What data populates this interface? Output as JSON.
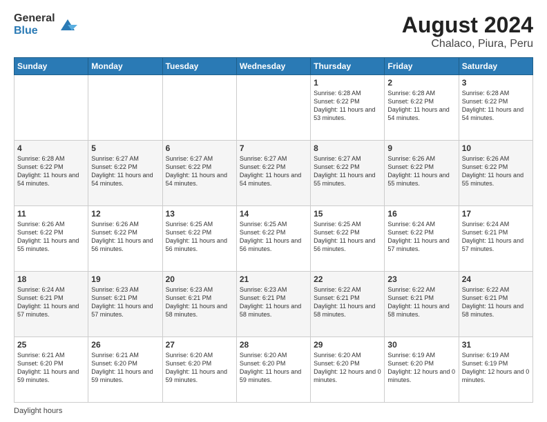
{
  "header": {
    "logo_general": "General",
    "logo_blue": "Blue",
    "title": "August 2024",
    "location": "Chalaco, Piura, Peru"
  },
  "weekdays": [
    "Sunday",
    "Monday",
    "Tuesday",
    "Wednesday",
    "Thursday",
    "Friday",
    "Saturday"
  ],
  "weeks": [
    [
      {
        "day": "",
        "info": ""
      },
      {
        "day": "",
        "info": ""
      },
      {
        "day": "",
        "info": ""
      },
      {
        "day": "",
        "info": ""
      },
      {
        "day": "1",
        "info": "Sunrise: 6:28 AM\nSunset: 6:22 PM\nDaylight: 11 hours\nand 53 minutes."
      },
      {
        "day": "2",
        "info": "Sunrise: 6:28 AM\nSunset: 6:22 PM\nDaylight: 11 hours\nand 54 minutes."
      },
      {
        "day": "3",
        "info": "Sunrise: 6:28 AM\nSunset: 6:22 PM\nDaylight: 11 hours\nand 54 minutes."
      }
    ],
    [
      {
        "day": "4",
        "info": "Sunrise: 6:28 AM\nSunset: 6:22 PM\nDaylight: 11 hours\nand 54 minutes."
      },
      {
        "day": "5",
        "info": "Sunrise: 6:27 AM\nSunset: 6:22 PM\nDaylight: 11 hours\nand 54 minutes."
      },
      {
        "day": "6",
        "info": "Sunrise: 6:27 AM\nSunset: 6:22 PM\nDaylight: 11 hours\nand 54 minutes."
      },
      {
        "day": "7",
        "info": "Sunrise: 6:27 AM\nSunset: 6:22 PM\nDaylight: 11 hours\nand 54 minutes."
      },
      {
        "day": "8",
        "info": "Sunrise: 6:27 AM\nSunset: 6:22 PM\nDaylight: 11 hours\nand 55 minutes."
      },
      {
        "day": "9",
        "info": "Sunrise: 6:26 AM\nSunset: 6:22 PM\nDaylight: 11 hours\nand 55 minutes."
      },
      {
        "day": "10",
        "info": "Sunrise: 6:26 AM\nSunset: 6:22 PM\nDaylight: 11 hours\nand 55 minutes."
      }
    ],
    [
      {
        "day": "11",
        "info": "Sunrise: 6:26 AM\nSunset: 6:22 PM\nDaylight: 11 hours\nand 55 minutes."
      },
      {
        "day": "12",
        "info": "Sunrise: 6:26 AM\nSunset: 6:22 PM\nDaylight: 11 hours\nand 56 minutes."
      },
      {
        "day": "13",
        "info": "Sunrise: 6:25 AM\nSunset: 6:22 PM\nDaylight: 11 hours\nand 56 minutes."
      },
      {
        "day": "14",
        "info": "Sunrise: 6:25 AM\nSunset: 6:22 PM\nDaylight: 11 hours\nand 56 minutes."
      },
      {
        "day": "15",
        "info": "Sunrise: 6:25 AM\nSunset: 6:22 PM\nDaylight: 11 hours\nand 56 minutes."
      },
      {
        "day": "16",
        "info": "Sunrise: 6:24 AM\nSunset: 6:22 PM\nDaylight: 11 hours\nand 57 minutes."
      },
      {
        "day": "17",
        "info": "Sunrise: 6:24 AM\nSunset: 6:21 PM\nDaylight: 11 hours\nand 57 minutes."
      }
    ],
    [
      {
        "day": "18",
        "info": "Sunrise: 6:24 AM\nSunset: 6:21 PM\nDaylight: 11 hours\nand 57 minutes."
      },
      {
        "day": "19",
        "info": "Sunrise: 6:23 AM\nSunset: 6:21 PM\nDaylight: 11 hours\nand 57 minutes."
      },
      {
        "day": "20",
        "info": "Sunrise: 6:23 AM\nSunset: 6:21 PM\nDaylight: 11 hours\nand 58 minutes."
      },
      {
        "day": "21",
        "info": "Sunrise: 6:23 AM\nSunset: 6:21 PM\nDaylight: 11 hours\nand 58 minutes."
      },
      {
        "day": "22",
        "info": "Sunrise: 6:22 AM\nSunset: 6:21 PM\nDaylight: 11 hours\nand 58 minutes."
      },
      {
        "day": "23",
        "info": "Sunrise: 6:22 AM\nSunset: 6:21 PM\nDaylight: 11 hours\nand 58 minutes."
      },
      {
        "day": "24",
        "info": "Sunrise: 6:22 AM\nSunset: 6:21 PM\nDaylight: 11 hours\nand 58 minutes."
      }
    ],
    [
      {
        "day": "25",
        "info": "Sunrise: 6:21 AM\nSunset: 6:20 PM\nDaylight: 11 hours\nand 59 minutes."
      },
      {
        "day": "26",
        "info": "Sunrise: 6:21 AM\nSunset: 6:20 PM\nDaylight: 11 hours\nand 59 minutes."
      },
      {
        "day": "27",
        "info": "Sunrise: 6:20 AM\nSunset: 6:20 PM\nDaylight: 11 hours\nand 59 minutes."
      },
      {
        "day": "28",
        "info": "Sunrise: 6:20 AM\nSunset: 6:20 PM\nDaylight: 11 hours\nand 59 minutes."
      },
      {
        "day": "29",
        "info": "Sunrise: 6:20 AM\nSunset: 6:20 PM\nDaylight: 12 hours\nand 0 minutes."
      },
      {
        "day": "30",
        "info": "Sunrise: 6:19 AM\nSunset: 6:20 PM\nDaylight: 12 hours\nand 0 minutes."
      },
      {
        "day": "31",
        "info": "Sunrise: 6:19 AM\nSunset: 6:19 PM\nDaylight: 12 hours\nand 0 minutes."
      }
    ]
  ],
  "footer": {
    "daylight_label": "Daylight hours"
  }
}
